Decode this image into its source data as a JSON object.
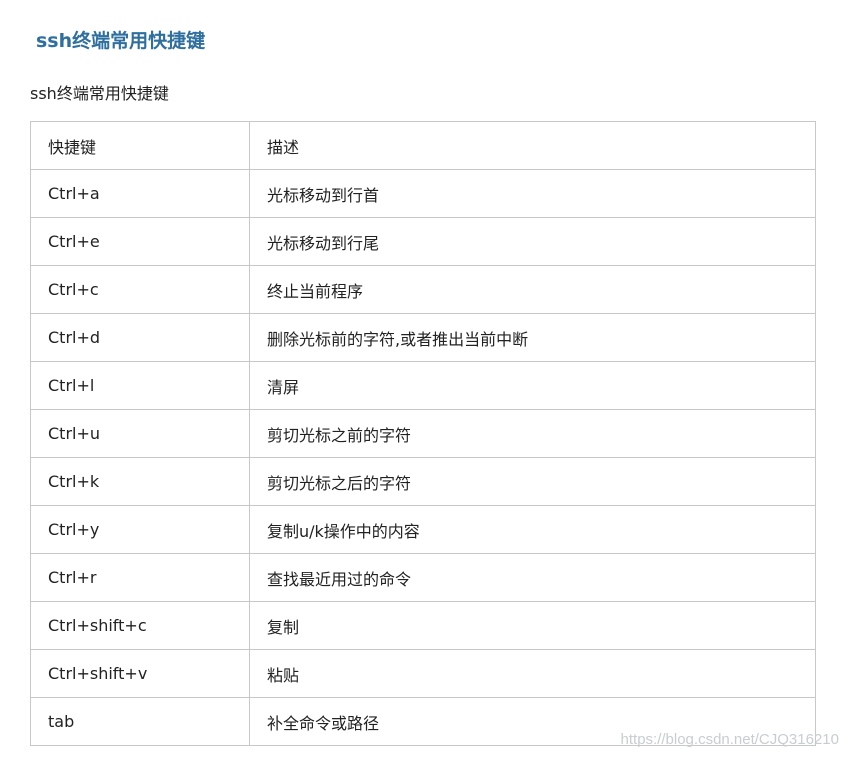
{
  "article": {
    "heading": "ssh终端常用快捷键",
    "intro": "ssh终端常用快捷键"
  },
  "table": {
    "headers": [
      "快捷键",
      "描述"
    ],
    "rows": [
      [
        "Ctrl+a",
        "光标移动到行首"
      ],
      [
        "Ctrl+e",
        "光标移动到行尾"
      ],
      [
        "Ctrl+c",
        "终止当前程序"
      ],
      [
        "Ctrl+d",
        "删除光标前的字符,或者推出当前中断"
      ],
      [
        "Ctrl+l",
        "清屏"
      ],
      [
        "Ctrl+u",
        "剪切光标之前的字符"
      ],
      [
        "Ctrl+k",
        "剪切光标之后的字符"
      ],
      [
        "Ctrl+y",
        "复制u/k操作中的内容"
      ],
      [
        "Ctrl+r",
        "查找最近用过的命令"
      ],
      [
        "Ctrl+shift+c",
        "复制"
      ],
      [
        "Ctrl+shift+v",
        "粘贴"
      ],
      [
        "tab",
        "补全命令或路径"
      ]
    ]
  },
  "watermark": "https://blog.csdn.net/CJQ316210",
  "colors": {
    "heading": "#2e6fa0",
    "border": "#c8c8c8",
    "text": "#222222",
    "watermark": "#c8cdd2"
  }
}
